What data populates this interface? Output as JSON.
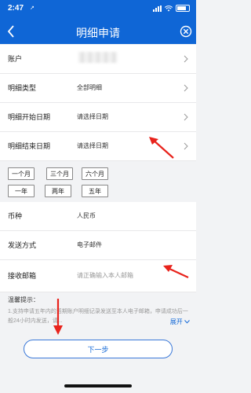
{
  "status": {
    "time": "2:47",
    "location_arrow": "↗"
  },
  "nav": {
    "title": "明细申请"
  },
  "rows": {
    "account": {
      "label": "账户"
    },
    "type": {
      "label": "明细类型",
      "value": "全部明细"
    },
    "start_date": {
      "label": "明细开始日期",
      "value": "请选择日期"
    },
    "end_date": {
      "label": "明细结束日期",
      "value": "请选择日期"
    },
    "currency": {
      "label": "币种",
      "value": "人民币"
    },
    "send_method": {
      "label": "发送方式",
      "value": "电子邮件"
    },
    "email": {
      "label": "接收邮箱",
      "placeholder": "请正确输入本人邮箱"
    }
  },
  "periods": [
    "一个月",
    "三个月",
    "六个月",
    "一年",
    "两年",
    "五年"
  ],
  "notice": {
    "title": "温馨提示：",
    "text": "1.支持申请五年内的活期账户明细记录发送至本人电子邮箱，申请成功后一般24小时内发送，请...",
    "more": "展开"
  },
  "next_button": "下一步",
  "colors": {
    "brand": "#0f66d6",
    "annotation_arrow": "#e8231c"
  }
}
